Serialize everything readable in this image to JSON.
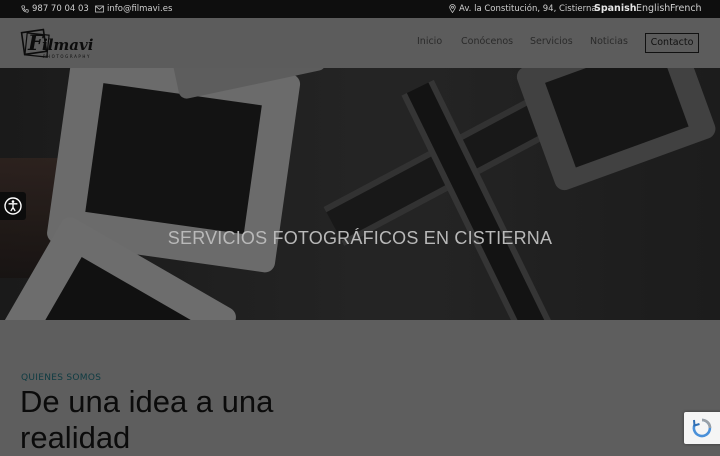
{
  "topbar": {
    "phone": "987 70 04 03",
    "email": "info@filmavi.es",
    "address": "Av. la Constitución, 94, Cistierna",
    "languages": [
      "Spanish",
      "English",
      "French"
    ]
  },
  "header": {
    "logo_text": "Filmavi",
    "logo_subtext": "PHOTOGRAPHY",
    "nav": [
      "Inicio",
      "Conócenos",
      "Servicios",
      "Noticias"
    ],
    "contact_label": "Contacto"
  },
  "hero": {
    "title": "SERVICIOS FOTOGRÁFICOS EN CISTIERNA"
  },
  "about": {
    "kicker": "QUIENES SOMOS",
    "headline": "De una idea a una realidad"
  },
  "icons": {
    "phone": "phone-icon",
    "email": "envelope-icon",
    "address": "map-pin-icon",
    "accessibility": "accessibility-icon",
    "recaptcha": "recaptcha-icon"
  },
  "colors": {
    "topbar_bg": "#0e0e0e",
    "page_bg": "#5e5e5e",
    "kicker": "#0e3b42"
  }
}
